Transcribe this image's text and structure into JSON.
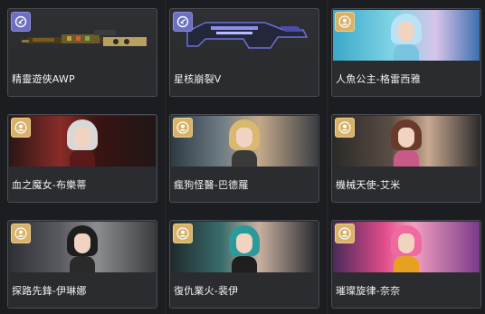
{
  "items": [
    {
      "name": "精靈遊俠AWP",
      "type": "weapon",
      "icon": "gun-icon"
    },
    {
      "name": "星核崩裂V",
      "type": "weapon",
      "icon": "gun-icon"
    },
    {
      "name": "人魚公主-格雷西雅",
      "type": "character",
      "icon": "user-icon"
    },
    {
      "name": "血之魔女-布樂蒂",
      "type": "character",
      "icon": "user-icon"
    },
    {
      "name": "瘋狗怪醫-巴德羅",
      "type": "character",
      "icon": "user-icon"
    },
    {
      "name": "機械天使-艾米",
      "type": "character",
      "icon": "user-icon"
    },
    {
      "name": "探路先鋒-伊琳娜",
      "type": "character",
      "icon": "user-icon"
    },
    {
      "name": "復仇業火-裴伊",
      "type": "character",
      "icon": "user-icon"
    },
    {
      "name": "璀璨旋律-奈奈",
      "type": "character",
      "icon": "user-icon"
    }
  ],
  "colors": {
    "background": "#1c1d20",
    "card": "#2a2b2f",
    "border": "#4c4d52",
    "weapon_badge": "#6d6fc2",
    "character_badge": "#d9b26a",
    "text": "#f2f2f2"
  }
}
